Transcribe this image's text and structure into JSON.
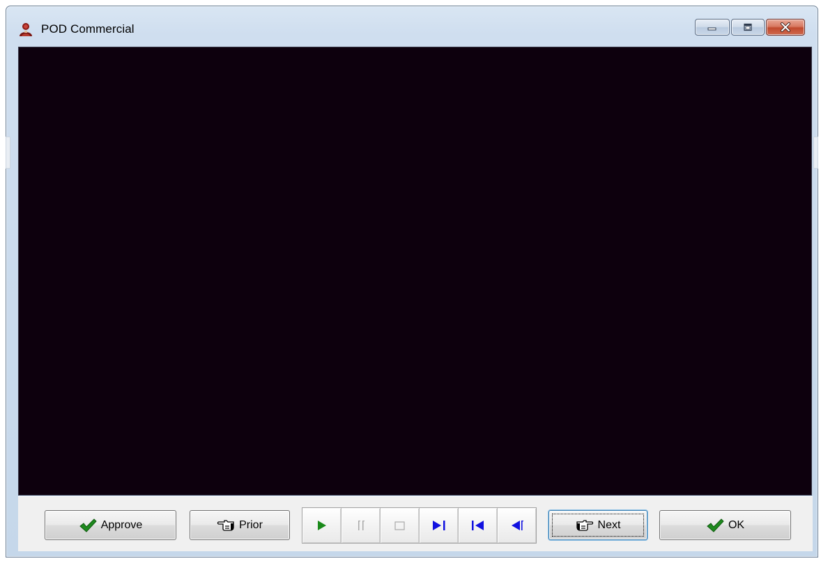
{
  "window": {
    "title": "POD Commercial",
    "icon": "app-person-icon"
  },
  "caption_buttons": {
    "minimize_icon": "minimize-icon",
    "maximize_icon": "maximize-icon",
    "close_icon": "close-icon",
    "close_color": "#c9563c"
  },
  "toolbar": {
    "approve_label": "Approve",
    "prior_label": "Prior",
    "next_label": "Next",
    "ok_label": "OK",
    "approve_icon": "checkmark-icon",
    "prior_icon": "hand-point-left-icon",
    "next_icon": "hand-point-right-icon",
    "ok_icon": "checkmark-icon"
  },
  "media_controls": [
    {
      "name": "play",
      "icon": "play-icon",
      "enabled": true,
      "color": "#1a8a1a"
    },
    {
      "name": "pause",
      "icon": "pause-icon",
      "enabled": false,
      "color": "#a8a8a8"
    },
    {
      "name": "stop",
      "icon": "stop-icon",
      "enabled": false,
      "color": "#a8a8a8"
    },
    {
      "name": "step-forward",
      "icon": "step-forward-icon",
      "enabled": true,
      "color": "#1010e0"
    },
    {
      "name": "skip-to-start",
      "icon": "skip-to-start-icon",
      "enabled": true,
      "color": "#1010e0"
    },
    {
      "name": "step-back",
      "icon": "step-back-icon",
      "enabled": true,
      "color": "#1010e0"
    }
  ],
  "colors": {
    "video_background": "#0d000d",
    "checkmark_green": "#1e8a1e"
  }
}
